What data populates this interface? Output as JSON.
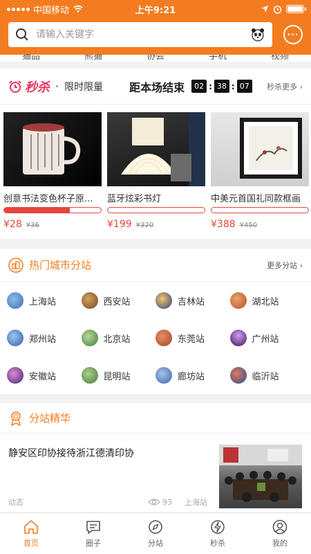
{
  "status_bar": {
    "carrier": "中国移动",
    "time": "上午9:21"
  },
  "search": {
    "placeholder": "请输入关键字"
  },
  "top_categories": [
    "猫品",
    "熊猫",
    "协会",
    "手机",
    "视频"
  ],
  "flash_sale": {
    "logo": "秒杀",
    "subtitle": "限时限量",
    "end_label": "距本场结束",
    "countdown": [
      "02",
      "38",
      "07"
    ],
    "more": "秒杀更多",
    "products": [
      {
        "name": "创意书法变色杯子原...",
        "sold_ratio": 0.68,
        "price": "¥28",
        "old_price": "¥36"
      },
      {
        "name": "蓝牙炫彩书灯",
        "sold_ratio": 0,
        "price": "¥199",
        "old_price": "¥320"
      },
      {
        "name": "中美元首国礼同款框画",
        "sold_ratio": 0,
        "price": "¥388",
        "old_price": "¥450"
      }
    ]
  },
  "cities": {
    "title": "热门城市分站",
    "more": "更多分站",
    "items": [
      {
        "name": "上海站",
        "color": "#3b6fb5"
      },
      {
        "name": "西安站",
        "color": "#6e4a2a"
      },
      {
        "name": "吉林站",
        "color": "#e0892b"
      },
      {
        "name": "湖北站",
        "color": "#b5502b"
      },
      {
        "name": "郑州站",
        "color": "#2f5fae"
      },
      {
        "name": "北京站",
        "color": "#3f7f3b"
      },
      {
        "name": "东莞站",
        "color": "#a2432c"
      },
      {
        "name": "广州站",
        "color": "#6a2a8f"
      },
      {
        "name": "安徽站",
        "color": "#8a3f9a"
      },
      {
        "name": "昆明站",
        "color": "#4d7a3a"
      },
      {
        "name": "廊坊站",
        "color": "#3a66a8"
      },
      {
        "name": "临沂站",
        "color": "#2a4d8f"
      }
    ]
  },
  "essence": {
    "title": "分站精华",
    "article": {
      "title": "静安区印协接待浙江德清印协",
      "category": "动态",
      "views": "93",
      "station": "上海站"
    }
  },
  "tabbar": [
    {
      "label": "首页",
      "icon": "home-icon",
      "active": true
    },
    {
      "label": "圈子",
      "icon": "chat-icon",
      "active": false
    },
    {
      "label": "分站",
      "icon": "compass-icon",
      "active": false
    },
    {
      "label": "秒杀",
      "icon": "lightning-icon",
      "active": false
    },
    {
      "label": "我的",
      "icon": "user-icon",
      "active": false
    }
  ],
  "colors": {
    "brand": "#f47c20",
    "sale": "#e8335d",
    "price": "#e8453c"
  }
}
